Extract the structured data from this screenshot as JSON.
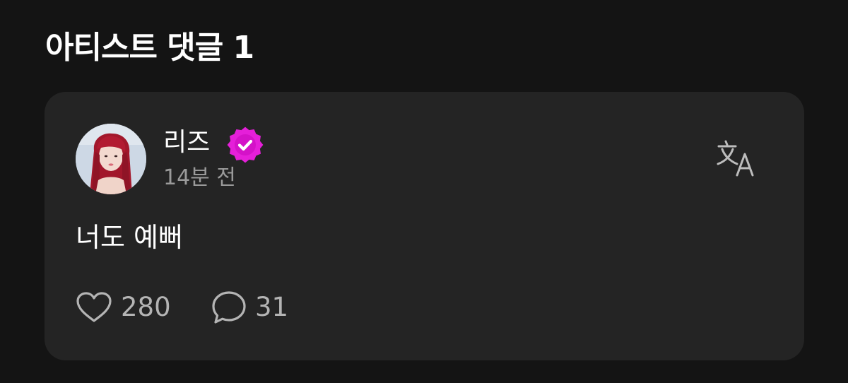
{
  "section": {
    "title": "아티스트 댓글 1"
  },
  "comment": {
    "author": "리즈",
    "verified": true,
    "timestamp": "14분 전",
    "body": "너도 예뻐",
    "likes": "280",
    "replies": "31"
  },
  "icons": {
    "verified": "verified-badge-icon",
    "translate": "translate-icon",
    "like": "heart-icon",
    "reply": "speech-bubble-icon"
  },
  "colors": {
    "background": "#141414",
    "card": "#242424",
    "badge": "#e51fd9",
    "muted_text": "#9a9a9a"
  }
}
